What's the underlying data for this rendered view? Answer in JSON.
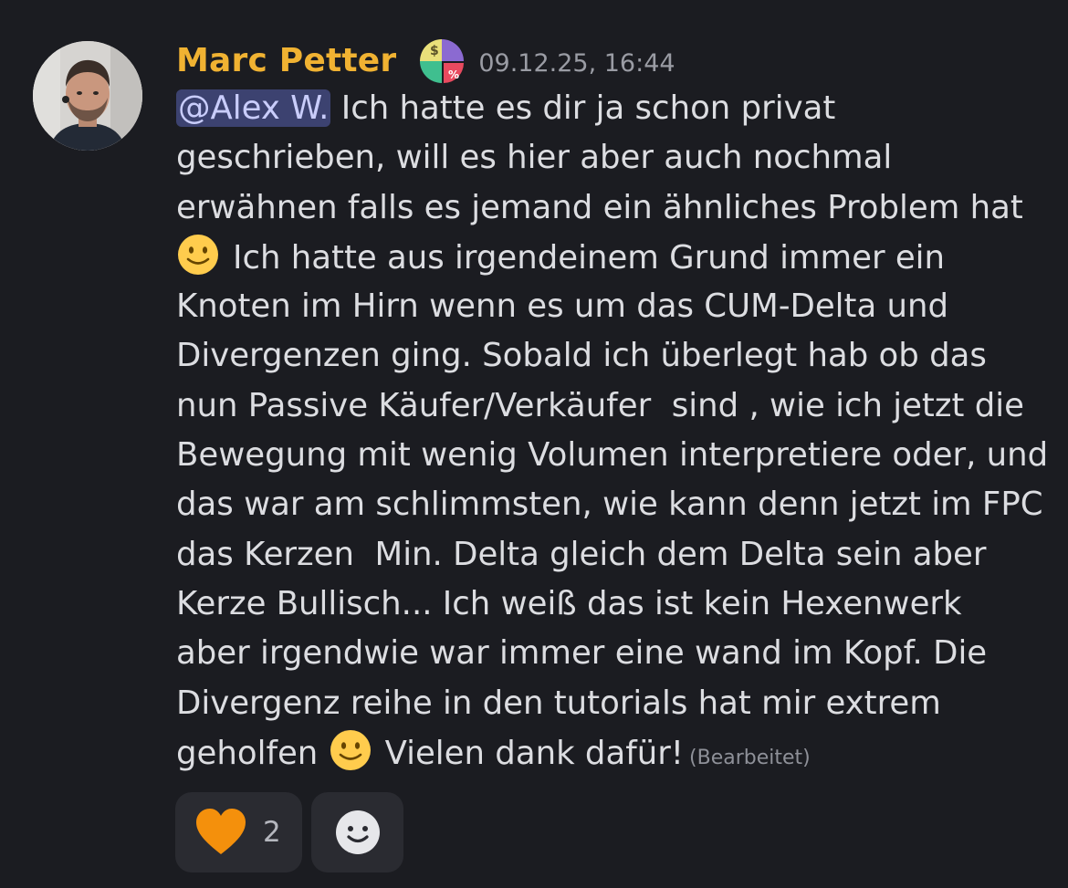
{
  "message": {
    "author": "Marc Petter",
    "timestamp": "09.12.25, 16:44",
    "role_icon": "money-pie-chart-icon",
    "avatar": "user-avatar-photo",
    "mention": "@Alex W.",
    "lines": [
      " Ich hatte es dir ja schon privat",
      "geschrieben, will es hier aber auch nochmal",
      "erwähnen falls es jemand ein ähnliches Problem hat",
      "Ich hatte aus irgendeinem Grund immer ein",
      "Knoten im Hirn wenn es um das CUM-Delta und",
      "Divergenzen ging. Sobald ich überlegt hab ob das",
      "nun Passive Käufer/Verkäufer  sind , wie ich jetzt die",
      "Bewegung mit wenig Volumen interpretiere oder, und",
      "das war am schlimmsten, wie kann denn jetzt im FPC",
      "das Kerzen  Min. Delta gleich dem Delta sein aber",
      "Kerze Bullisch... Ich weiß das ist kein Hexenwerk",
      "aber irgendwie war immer eine wand im Kopf. Die",
      "Divergenz reihe in den tutorials hat mir extrem",
      "geholfen ",
      "Vielen dank dafür!"
    ],
    "edited_label": "(Bearbeitet)",
    "emoji": "slightly-smiling-face"
  },
  "reactions": [
    {
      "emoji": "orange-heart",
      "count": "2"
    },
    {
      "emoji": "add-reaction-smiley-icon"
    }
  ],
  "colors": {
    "background": "#1b1c21",
    "username": "#f0b232",
    "text": "#dcdde1",
    "mention_bg": "#3c4270",
    "mention_text": "#c9cdfb",
    "reaction_bg": "#2a2b31",
    "heart": "#f4900c"
  }
}
